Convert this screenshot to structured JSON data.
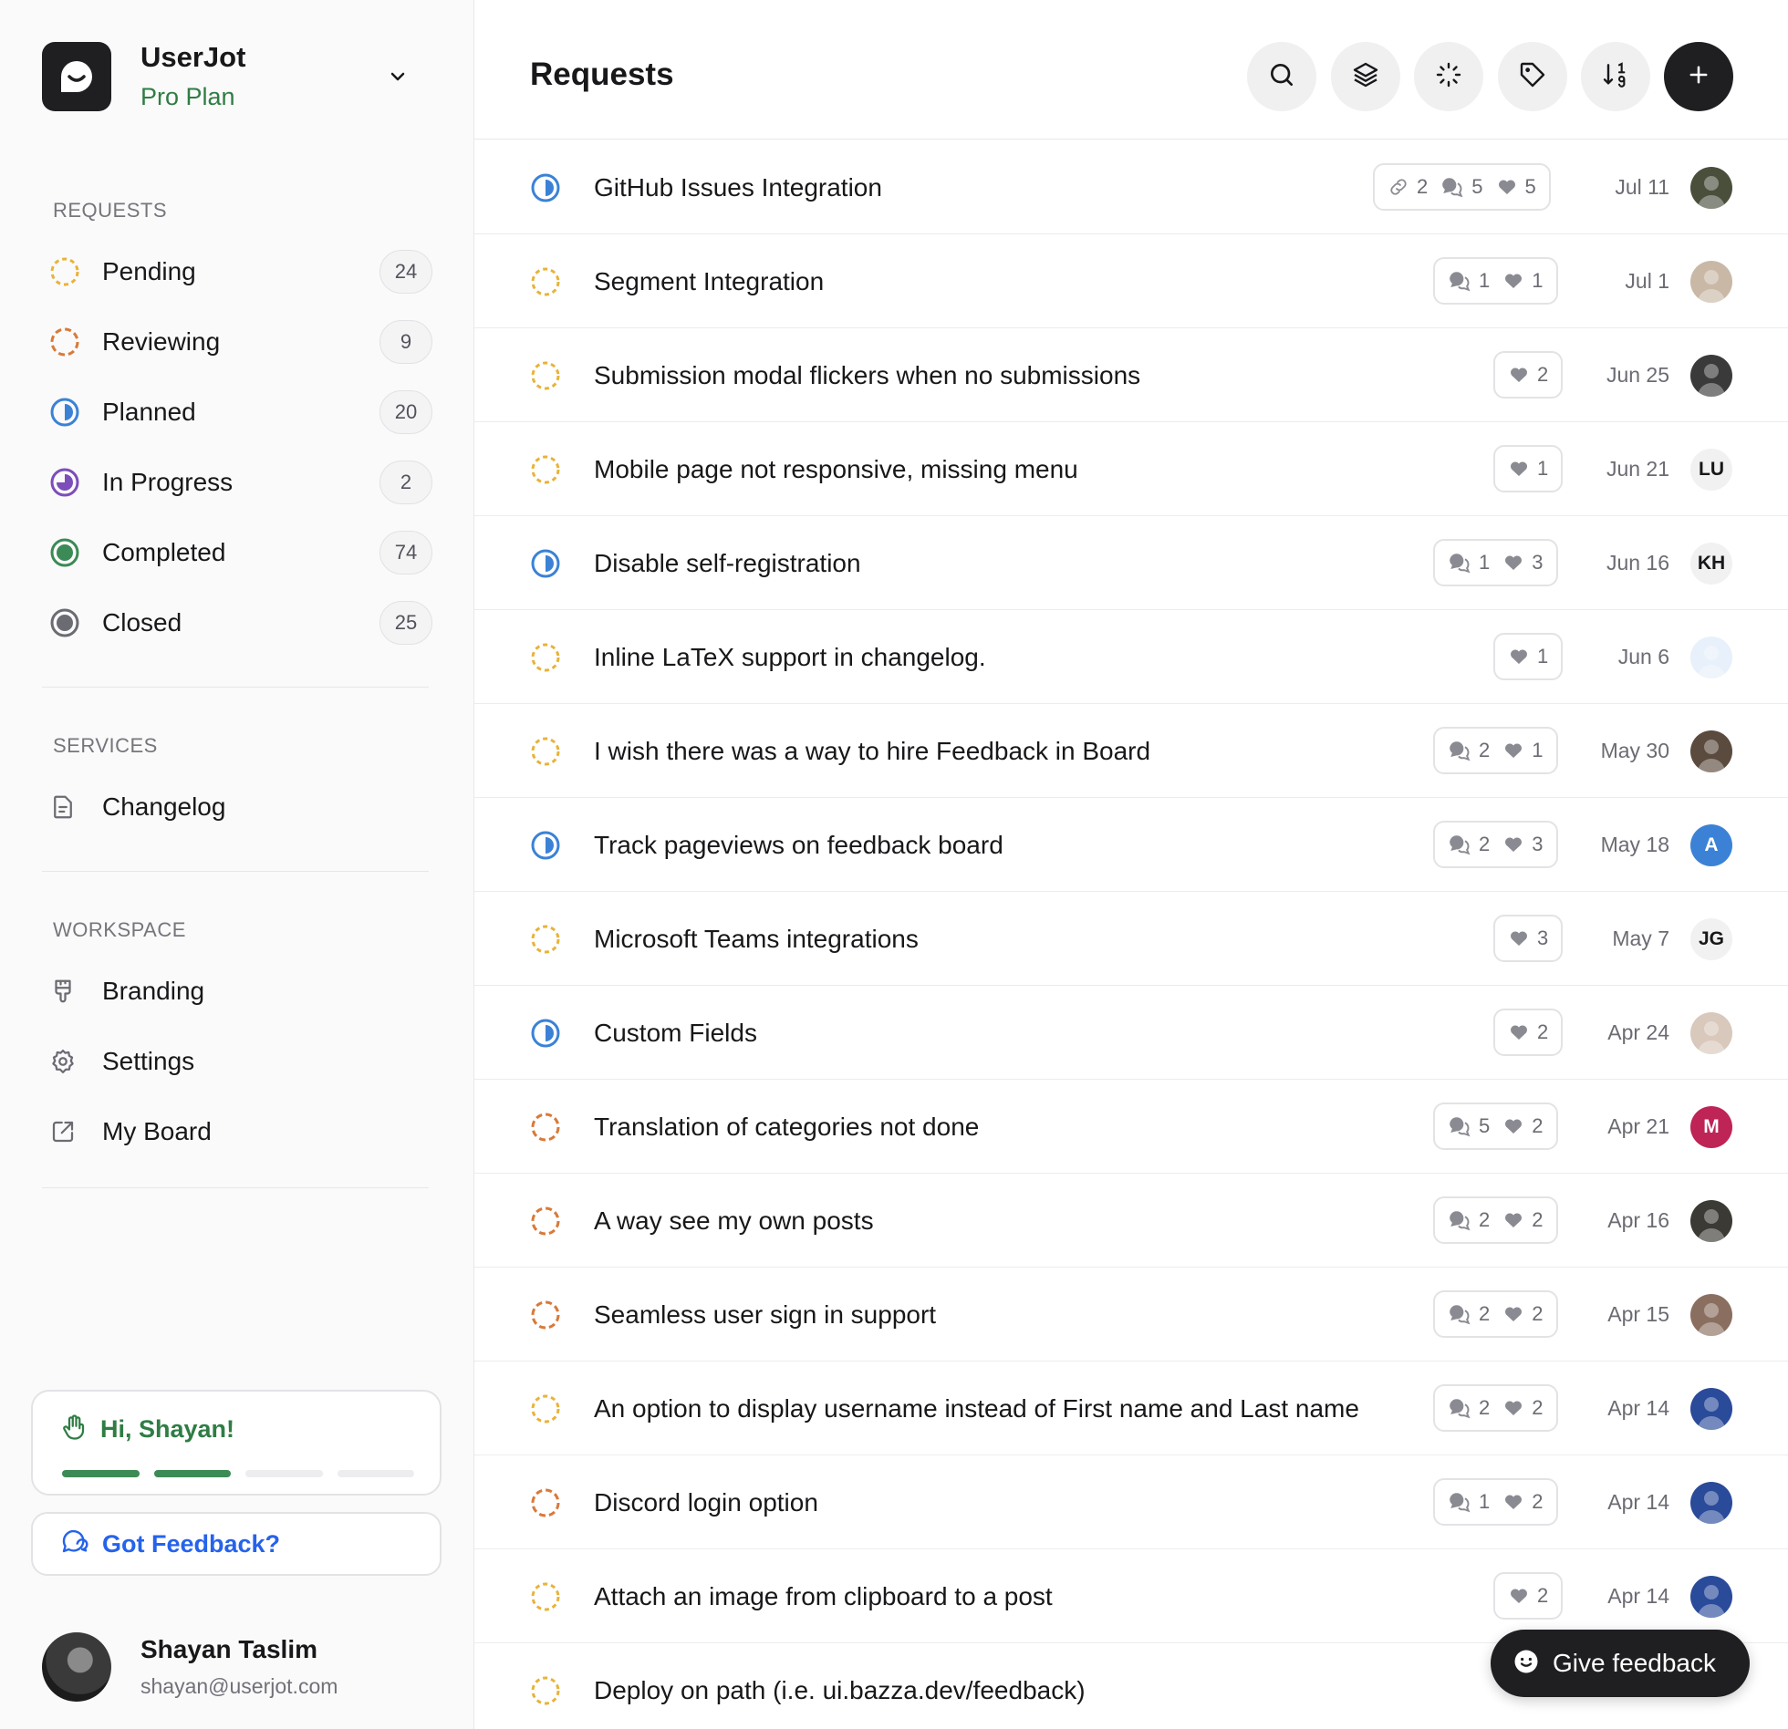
{
  "workspace": {
    "name": "UserJot",
    "plan": "Pro Plan"
  },
  "sections": {
    "requests": "REQUESTS",
    "services": "SERVICES",
    "workspace": "WORKSPACE"
  },
  "nav_statuses": [
    {
      "label": "Pending",
      "count": "24",
      "color": "#e8b339"
    },
    {
      "label": "Reviewing",
      "count": "9",
      "color": "#d97a3a"
    },
    {
      "label": "Planned",
      "count": "20",
      "color": "#3b82d6"
    },
    {
      "label": "In Progress",
      "count": "2",
      "color": "#7c4dbb"
    },
    {
      "label": "Completed",
      "count": "74",
      "color": "#3c8a55"
    },
    {
      "label": "Closed",
      "count": "25",
      "color": "#6b6b73"
    }
  ],
  "services": [
    {
      "label": "Changelog",
      "icon": "document-icon"
    }
  ],
  "workspace_items": [
    {
      "label": "Branding",
      "icon": "paintbrush-icon"
    },
    {
      "label": "Settings",
      "icon": "gear-icon"
    },
    {
      "label": "My Board",
      "icon": "external-link-icon"
    }
  ],
  "onboarding": {
    "greeting": "Hi, Shayan!",
    "steps_done": 2,
    "steps_total": 4
  },
  "feedback_card": {
    "label": "Got Feedback?"
  },
  "user": {
    "name": "Shayan Taslim",
    "email": "shayan@userjot.com"
  },
  "header": {
    "title": "Requests"
  },
  "requests": [
    {
      "title": "GitHub Issues Integration",
      "status": "planned",
      "links": "2",
      "comments": "5",
      "votes": "5",
      "date": "Jul 11",
      "avatar": "",
      "avatar_bg": "#4a4f3c"
    },
    {
      "title": "Segment Integration",
      "status": "pending",
      "links": "",
      "comments": "1",
      "votes": "1",
      "date": "Jul 1",
      "avatar": "",
      "avatar_bg": "#c9b8a6"
    },
    {
      "title": "Submission modal flickers when no submissions",
      "status": "pending",
      "links": "",
      "comments": "",
      "votes": "2",
      "date": "Jun 25",
      "avatar": "",
      "avatar_bg": "#3a3a3a"
    },
    {
      "title": "Mobile page not responsive, missing menu",
      "status": "pending",
      "links": "",
      "comments": "",
      "votes": "1",
      "date": "Jun 21",
      "avatar": "LU",
      "avatar_bg": "#f1f1f2"
    },
    {
      "title": "Disable self-registration",
      "status": "planned",
      "links": "",
      "comments": "1",
      "votes": "3",
      "date": "Jun 16",
      "avatar": "KH",
      "avatar_bg": "#f1f1f2"
    },
    {
      "title": "Inline LaTeX support in changelog.",
      "status": "pending",
      "links": "",
      "comments": "",
      "votes": "1",
      "date": "Jun 6",
      "avatar": "",
      "avatar_bg": "#e8f0fb"
    },
    {
      "title": "I wish there was a way to hire Feedback in Board",
      "status": "pending",
      "links": "",
      "comments": "2",
      "votes": "1",
      "date": "May 30",
      "avatar": "",
      "avatar_bg": "#5b4a3e"
    },
    {
      "title": "Track pageviews on feedback board",
      "status": "planned",
      "links": "",
      "comments": "2",
      "votes": "3",
      "date": "May 18",
      "avatar": "A",
      "avatar_bg": "#3b82d6"
    },
    {
      "title": "Microsoft Teams integrations",
      "status": "pending",
      "links": "",
      "comments": "",
      "votes": "3",
      "date": "May 7",
      "avatar": "JG",
      "avatar_bg": "#f1f1f2"
    },
    {
      "title": "Custom Fields",
      "status": "planned",
      "links": "",
      "comments": "",
      "votes": "2",
      "date": "Apr 24",
      "avatar": "",
      "avatar_bg": "#d9c8bc"
    },
    {
      "title": "Translation of categories not done",
      "status": "reviewing",
      "links": "",
      "comments": "5",
      "votes": "2",
      "date": "Apr 21",
      "avatar": "M",
      "avatar_bg": "#be2456"
    },
    {
      "title": "A way see my own posts",
      "status": "reviewing",
      "links": "",
      "comments": "2",
      "votes": "2",
      "date": "Apr 16",
      "avatar": "",
      "avatar_bg": "#3b3a34"
    },
    {
      "title": "Seamless user sign in support",
      "status": "reviewing",
      "links": "",
      "comments": "2",
      "votes": "2",
      "date": "Apr 15",
      "avatar": "",
      "avatar_bg": "#8a6f60"
    },
    {
      "title": "An option to display username instead of First name and Last name",
      "status": "pending",
      "links": "",
      "comments": "2",
      "votes": "2",
      "date": "Apr 14",
      "avatar": "",
      "avatar_bg": "#2a4a9a"
    },
    {
      "title": "Discord login option",
      "status": "reviewing",
      "links": "",
      "comments": "1",
      "votes": "2",
      "date": "Apr 14",
      "avatar": "",
      "avatar_bg": "#2a4a9a"
    },
    {
      "title": "Attach an image from clipboard to a post",
      "status": "pending",
      "links": "",
      "comments": "",
      "votes": "2",
      "date": "Apr 14",
      "avatar": "",
      "avatar_bg": "#2a4a9a"
    },
    {
      "title": "Deploy on path (i.e. ui.bazza.dev/feedback)",
      "status": "pending",
      "links": "",
      "comments": "",
      "votes": "",
      "date": "",
      "avatar": "",
      "avatar_bg": "#ffffff"
    }
  ],
  "give_feedback": {
    "label": "Give feedback"
  },
  "colors": {
    "pending": "#e8b339",
    "reviewing": "#d97a3a",
    "planned": "#3b82d6",
    "in_progress": "#7c4dbb",
    "completed": "#3c8a55",
    "closed": "#6b6b73"
  }
}
